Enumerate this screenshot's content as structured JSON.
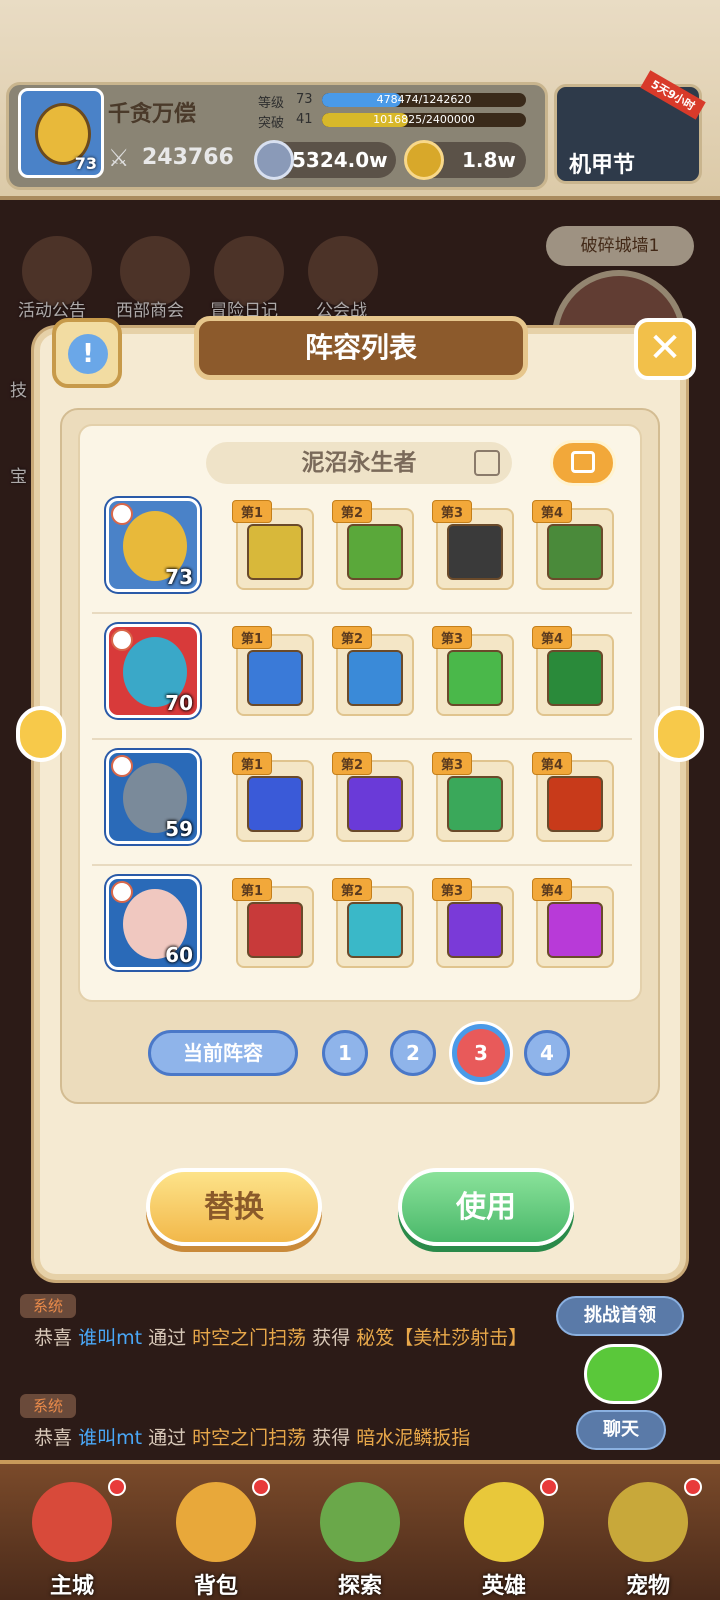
{
  "player": {
    "name": "千贪万偿",
    "avatar_level": "73",
    "power": "243766",
    "level_label": "等级",
    "level_value": "73",
    "level_progress": "478474/1242620",
    "level_fraction": 0.385,
    "break_label": "突破",
    "break_value": "41",
    "break_progress": "1016825/2400000",
    "break_fraction": 0.424
  },
  "resources": {
    "gems": "5324.0w",
    "gold": "1.8w"
  },
  "event": {
    "name": "机甲节",
    "ribbon": "5天9小时"
  },
  "background": {
    "menu": [
      "活动公告",
      "西部商会",
      "冒险日记",
      "公会战"
    ],
    "side_top": "破碎城墙1",
    "side_left_1": "技",
    "side_left_2": "宝"
  },
  "panel": {
    "title": "阵容列表",
    "info_label": "!",
    "close_label": "✕"
  },
  "roster": {
    "name": "泥沼永生者",
    "rows": [
      {
        "level": "73",
        "hero_color": "#4a82c8",
        "face": "#e8b93a",
        "skills": [
          {
            "tag": "第1",
            "color": "#d8b83a"
          },
          {
            "tag": "第2",
            "color": "#5aa83a"
          },
          {
            "tag": "第3",
            "color": "#3a3a3a"
          },
          {
            "tag": "第4",
            "color": "#4a8a3a"
          }
        ]
      },
      {
        "level": "70",
        "hero_color": "#d83a3a",
        "face": "#3aa8c8",
        "skills": [
          {
            "tag": "第1",
            "color": "#3a7ad8"
          },
          {
            "tag": "第2",
            "color": "#3a8ad8"
          },
          {
            "tag": "第3",
            "color": "#4ab84a"
          },
          {
            "tag": "第4",
            "color": "#2a8a3a"
          }
        ]
      },
      {
        "level": "59",
        "hero_color": "#2a6ab8",
        "face": "#7a8a9a",
        "skills": [
          {
            "tag": "第1",
            "color": "#3a5ad8"
          },
          {
            "tag": "第2",
            "color": "#6a3ad8"
          },
          {
            "tag": "第3",
            "color": "#3aa85a"
          },
          {
            "tag": "第4",
            "color": "#c83a1a"
          }
        ]
      },
      {
        "level": "60",
        "hero_color": "#2a6ab8",
        "face": "#f0c8c0",
        "skills": [
          {
            "tag": "第1",
            "color": "#c83a3a"
          },
          {
            "tag": "第2",
            "color": "#3ab8c8"
          },
          {
            "tag": "第3",
            "color": "#7a3ad8"
          },
          {
            "tag": "第4",
            "color": "#b83ad8"
          }
        ]
      }
    ]
  },
  "pager": {
    "current_label": "当前阵容",
    "pages": [
      "1",
      "2",
      "3",
      "4"
    ],
    "active": "3"
  },
  "actions": {
    "replace": "替换",
    "use": "使用"
  },
  "chat": {
    "tag": "系统",
    "lines": [
      {
        "a": "恭喜",
        "player": "谁叫mt",
        "b": "通过",
        "place": "时空之门扫荡",
        "c": "获得",
        "item": "秘笈【美杜莎射击】"
      },
      {
        "a": "恭喜",
        "player": "谁叫mt",
        "b": "通过",
        "place": "时空之门扫荡",
        "c": "获得",
        "item": "暗水泥鳞扳指"
      }
    ]
  },
  "side": {
    "challenge": "挑战首领",
    "chat": "聊天"
  },
  "nav": [
    {
      "label": "主城",
      "color": "#d84a3a"
    },
    {
      "label": "背包",
      "color": "#e8a83a"
    },
    {
      "label": "探索",
      "color": "#6aa84a"
    },
    {
      "label": "英雄",
      "color": "#e8c83a"
    },
    {
      "label": "宠物",
      "color": "#c8a83a"
    }
  ]
}
